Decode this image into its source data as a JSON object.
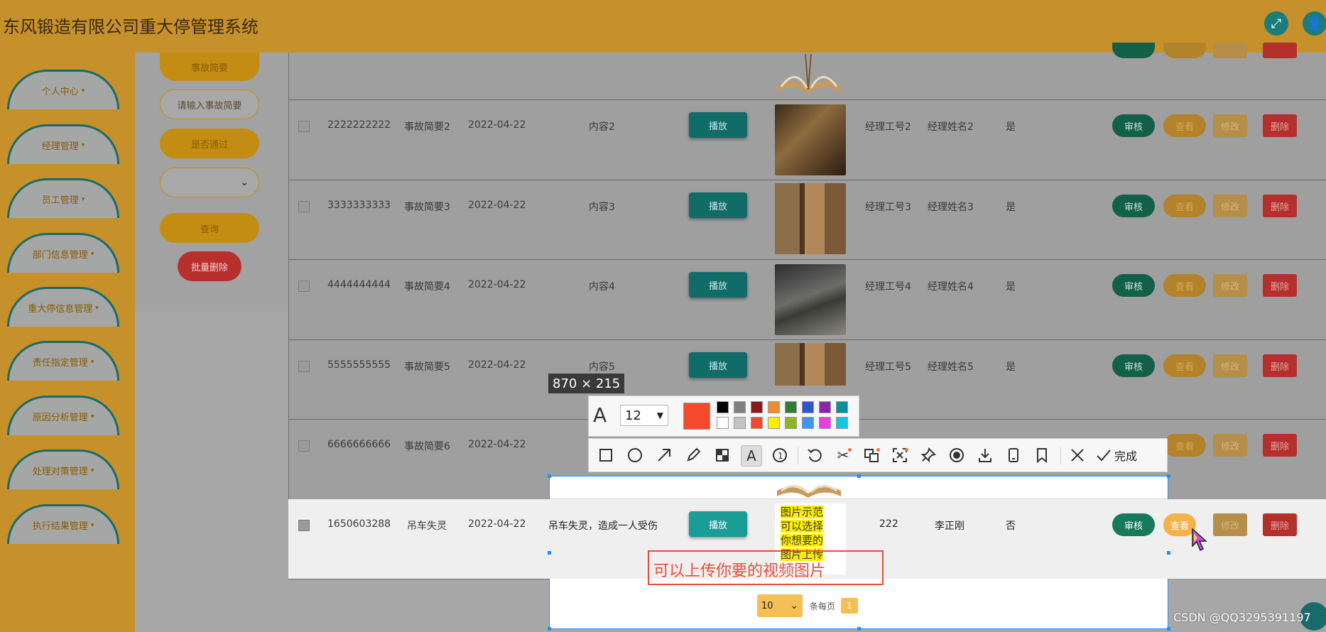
{
  "header": {
    "title": "东风锻造有限公司重大停管理系统"
  },
  "sidebar": {
    "items": [
      {
        "label": "个人中心"
      },
      {
        "label": "经理管理"
      },
      {
        "label": "员工管理"
      },
      {
        "label": "部门信息管理"
      },
      {
        "label": "重大停信息管理"
      },
      {
        "label": "责任指定管理"
      },
      {
        "label": "原因分析管理"
      },
      {
        "label": "处理对策管理"
      },
      {
        "label": "执行结果管理"
      }
    ]
  },
  "search": {
    "summary_label": "事故简要",
    "summary_placeholder": "请输入事故简要",
    "passed_label": "是否通过",
    "query_button": "查询",
    "batch_delete": "批量删除"
  },
  "table": {
    "play_label": "播放",
    "actions": {
      "audit": "审核",
      "view": "查看",
      "edit": "修改",
      "delete": "删除"
    },
    "rows": [
      {
        "id": "2222222222",
        "summary": "事故简要2",
        "date": "2022-04-22",
        "content": "内容2",
        "manager_no": "经理工号2",
        "manager_name": "经理姓名2",
        "passed": "是"
      },
      {
        "id": "3333333333",
        "summary": "事故简要3",
        "date": "2022-04-22",
        "content": "内容3",
        "manager_no": "经理工号3",
        "manager_name": "经理姓名3",
        "passed": "是"
      },
      {
        "id": "4444444444",
        "summary": "事故简要4",
        "date": "2022-04-22",
        "content": "内容4",
        "manager_no": "经理工号4",
        "manager_name": "经理姓名4",
        "passed": "是"
      },
      {
        "id": "5555555555",
        "summary": "事故简要5",
        "date": "2022-04-22",
        "content": "内容5",
        "manager_no": "经理工号5",
        "manager_name": "经理姓名5",
        "passed": "是"
      },
      {
        "id": "6666666666",
        "summary": "事故简要6",
        "date": "2022-04-22",
        "content": "",
        "manager_no": "",
        "manager_name": "",
        "passed": ""
      },
      {
        "id": "1650603288",
        "summary": "吊车失灵",
        "date": "2022-04-22",
        "content": "吊车失灵，造成一人受伤",
        "manager_no": "222",
        "manager_name": "李正刚",
        "passed": "否"
      }
    ],
    "sample_image_text": "图片示范\n可以选择\n你想要的\n图片上传"
  },
  "pagination": {
    "page_size": "10",
    "per_page_label": "条每页",
    "current_page": "1"
  },
  "screenshot_tool": {
    "size_label": "870 × 215",
    "font_size": "12",
    "done_label": "完成",
    "annotation_text": "可以上传你要的视频图片",
    "current_color": "#f4492c",
    "palette_row1": [
      "#000000",
      "#7f7f7f",
      "#8b1a1a",
      "#f08c30",
      "#2e7d32",
      "#2f55d4",
      "#8e24aa",
      "#0a8f9a"
    ],
    "palette_row2": [
      "#ffffff",
      "#c3c3c3",
      "#f4492c",
      "#ffee00",
      "#8bb81f",
      "#3f95f0",
      "#ef3ae0",
      "#12c6e0"
    ]
  },
  "watermark": "CSDN @QQ3295391197"
}
